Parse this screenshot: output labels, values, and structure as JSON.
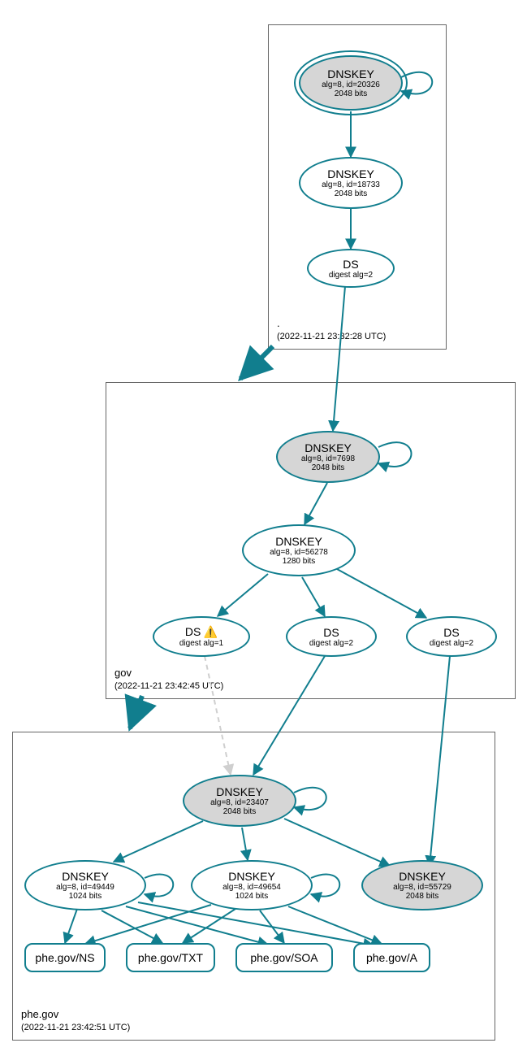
{
  "colors": {
    "stroke": "#117e8e",
    "nodeFill": "#d6d6d6"
  },
  "zones": {
    "root": {
      "name": ".",
      "timestamp": "(2022-11-21 23:32:28 UTC)"
    },
    "gov": {
      "name": "gov",
      "timestamp": "(2022-11-21 23:42:45 UTC)"
    },
    "phe": {
      "name": "phe.gov",
      "timestamp": "(2022-11-21 23:42:51 UTC)"
    }
  },
  "nodes": {
    "root_ksk": {
      "title": "DNSKEY",
      "l1": "alg=8, id=20326",
      "l2": "2048 bits"
    },
    "root_zsk": {
      "title": "DNSKEY",
      "l1": "alg=8, id=18733",
      "l2": "2048 bits"
    },
    "root_ds": {
      "title": "DS",
      "l1": "digest alg=2"
    },
    "gov_ksk": {
      "title": "DNSKEY",
      "l1": "alg=8, id=7698",
      "l2": "2048 bits"
    },
    "gov_zsk": {
      "title": "DNSKEY",
      "l1": "alg=8, id=56278",
      "l2": "1280 bits"
    },
    "gov_ds1": {
      "title": "DS",
      "warn": "⚠️",
      "l1": "digest alg=1"
    },
    "gov_ds2": {
      "title": "DS",
      "l1": "digest alg=2"
    },
    "gov_ds3": {
      "title": "DS",
      "l1": "digest alg=2"
    },
    "phe_ksk": {
      "title": "DNSKEY",
      "l1": "alg=8, id=23407",
      "l2": "2048 bits"
    },
    "phe_zsk1": {
      "title": "DNSKEY",
      "l1": "alg=8, id=49449",
      "l2": "1024 bits"
    },
    "phe_zsk2": {
      "title": "DNSKEY",
      "l1": "alg=8, id=49654",
      "l2": "1024 bits"
    },
    "phe_extra": {
      "title": "DNSKEY",
      "l1": "alg=8, id=55729",
      "l2": "2048 bits"
    },
    "rr_ns": {
      "title": "phe.gov/NS"
    },
    "rr_txt": {
      "title": "phe.gov/TXT"
    },
    "rr_soa": {
      "title": "phe.gov/SOA"
    },
    "rr_a": {
      "title": "phe.gov/A"
    }
  }
}
